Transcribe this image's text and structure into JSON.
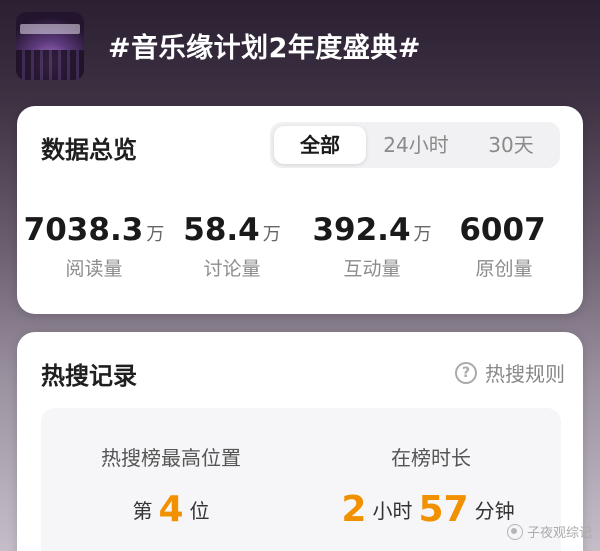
{
  "topic": {
    "title": "#音乐缘计划2年度盛典#"
  },
  "overview": {
    "title": "数据总览",
    "tabs": [
      {
        "label": "全部",
        "active": true
      },
      {
        "label": "24小时",
        "active": false
      },
      {
        "label": "30天",
        "active": false
      }
    ],
    "stats": [
      {
        "value": "7038.3",
        "unit": "万",
        "label": "阅读量"
      },
      {
        "value": "58.4",
        "unit": "万",
        "label": "讨论量"
      },
      {
        "value": "392.4",
        "unit": "万",
        "label": "互动量"
      },
      {
        "value": "6007",
        "unit": "",
        "label": "原创量"
      }
    ]
  },
  "hot_search": {
    "title": "热搜记录",
    "rules_label": "热搜规则",
    "rules_icon": "?",
    "highest_position": {
      "label": "热搜榜最高位置",
      "prefix": "第",
      "value": "4",
      "suffix": "位"
    },
    "duration": {
      "label": "在榜时长",
      "hours": "2",
      "hours_unit": "小时",
      "minutes": "57",
      "minutes_unit": "分钟"
    }
  },
  "watermark": {
    "text": "子夜观综记"
  },
  "colors": {
    "accent": "#f29100",
    "title_text": "#ffffff"
  }
}
